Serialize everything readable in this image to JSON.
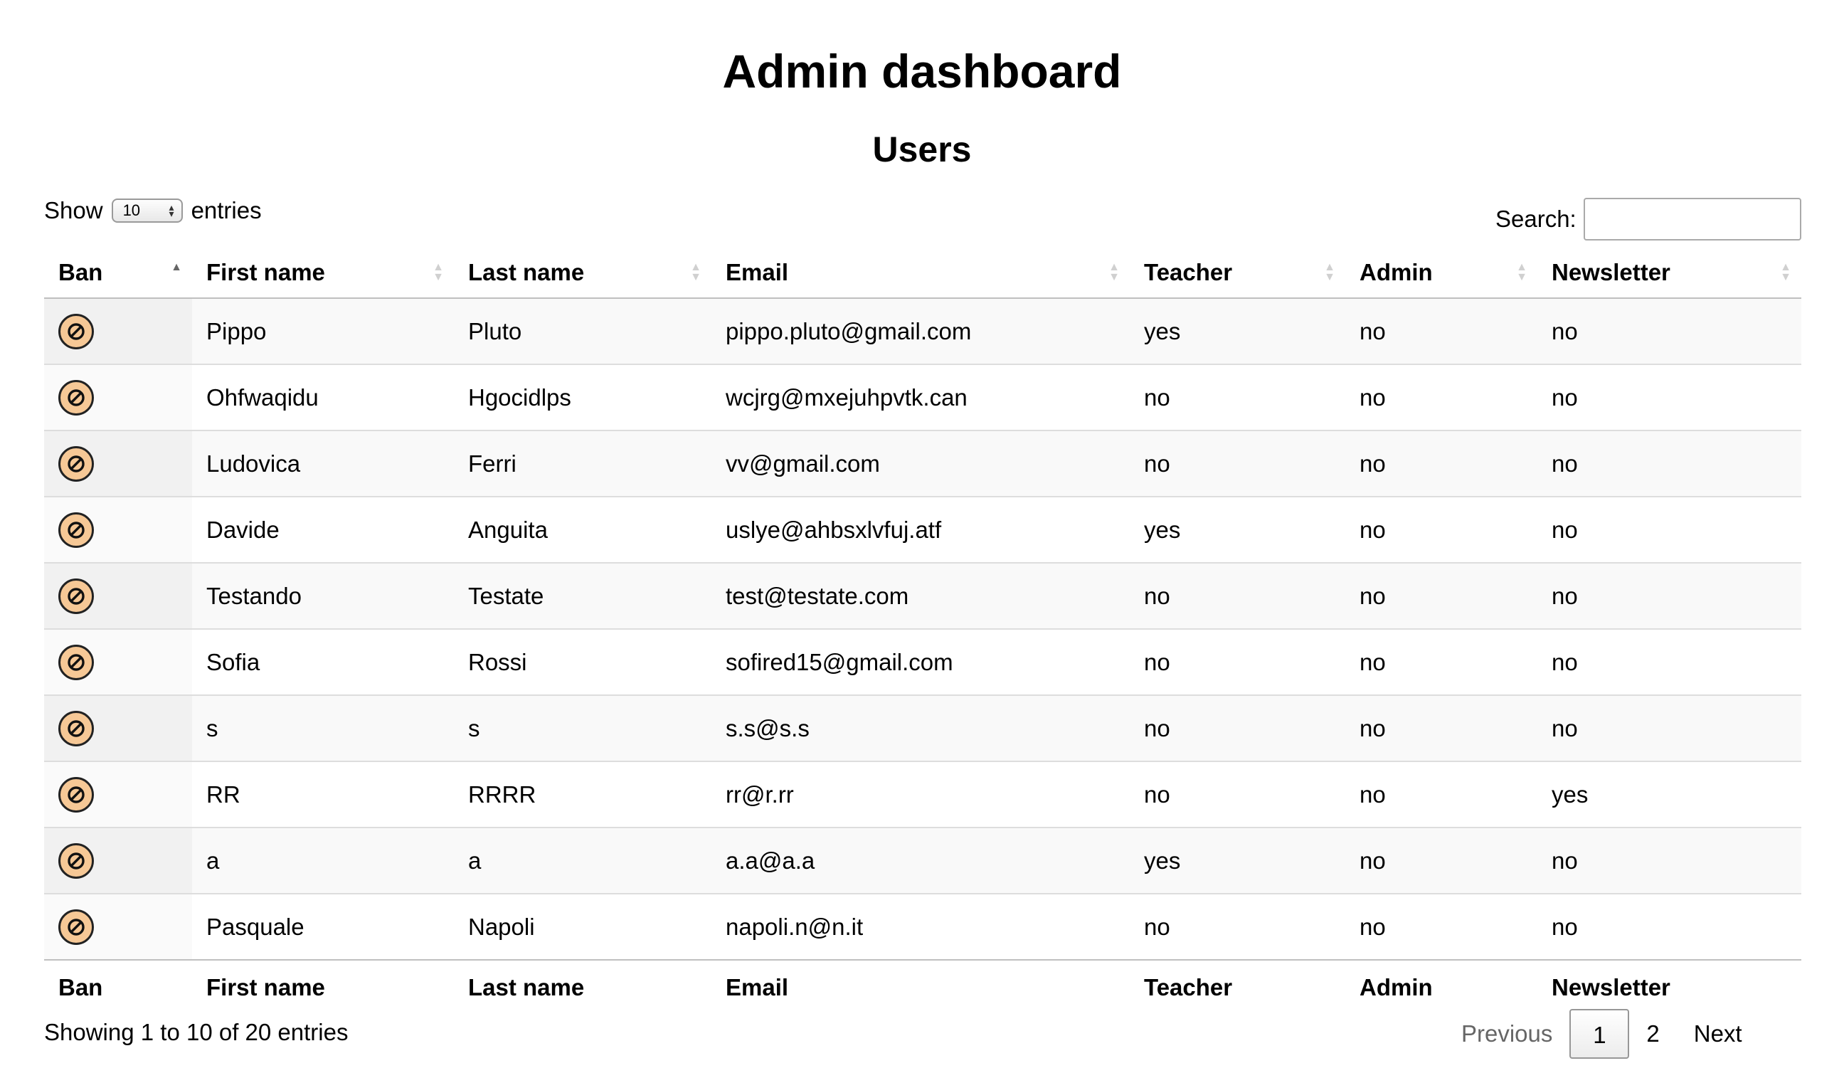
{
  "page": {
    "title": "Admin dashboard",
    "subtitle": "Users"
  },
  "length_menu": {
    "prefix": "Show",
    "selected": "10",
    "suffix": "entries"
  },
  "search": {
    "label": "Search:",
    "value": ""
  },
  "table": {
    "headers": [
      "Ban",
      "First name",
      "Last name",
      "Email",
      "Teacher",
      "Admin",
      "Newsletter"
    ],
    "sorted_column": "Ban",
    "ban_icon": "ban-icon",
    "ban_color": "#f6c896",
    "rows": [
      {
        "first": "Pippo",
        "last": "Pluto",
        "email": "pippo.pluto@gmail.com",
        "teacher": "yes",
        "admin": "no",
        "newsletter": "no"
      },
      {
        "first": "Ohfwaqidu",
        "last": "Hgocidlps",
        "email": "wcjrg@mxejuhpvtk.can",
        "teacher": "no",
        "admin": "no",
        "newsletter": "no"
      },
      {
        "first": "Ludovica",
        "last": "Ferri",
        "email": "vv@gmail.com",
        "teacher": "no",
        "admin": "no",
        "newsletter": "no"
      },
      {
        "first": "Davide",
        "last": "Anguita",
        "email": "uslye@ahbsxlvfuj.atf",
        "teacher": "yes",
        "admin": "no",
        "newsletter": "no"
      },
      {
        "first": "Testando",
        "last": "Testate",
        "email": "test@testate.com",
        "teacher": "no",
        "admin": "no",
        "newsletter": "no"
      },
      {
        "first": "Sofia",
        "last": "Rossi",
        "email": "sofired15@gmail.com",
        "teacher": "no",
        "admin": "no",
        "newsletter": "no"
      },
      {
        "first": "s",
        "last": "s",
        "email": "s.s@s.s",
        "teacher": "no",
        "admin": "no",
        "newsletter": "no"
      },
      {
        "first": "RR",
        "last": "RRRR",
        "email": "rr@r.rr",
        "teacher": "no",
        "admin": "no",
        "newsletter": "yes"
      },
      {
        "first": "a",
        "last": "a",
        "email": "a.a@a.a",
        "teacher": "yes",
        "admin": "no",
        "newsletter": "no"
      },
      {
        "first": "Pasquale",
        "last": "Napoli",
        "email": "napoli.n@n.it",
        "teacher": "no",
        "admin": "no",
        "newsletter": "no"
      }
    ]
  },
  "info": "Showing 1 to 10 of 20 entries",
  "pagination": {
    "previous": "Previous",
    "pages": [
      "1",
      "2"
    ],
    "current": "1",
    "next": "Next"
  }
}
